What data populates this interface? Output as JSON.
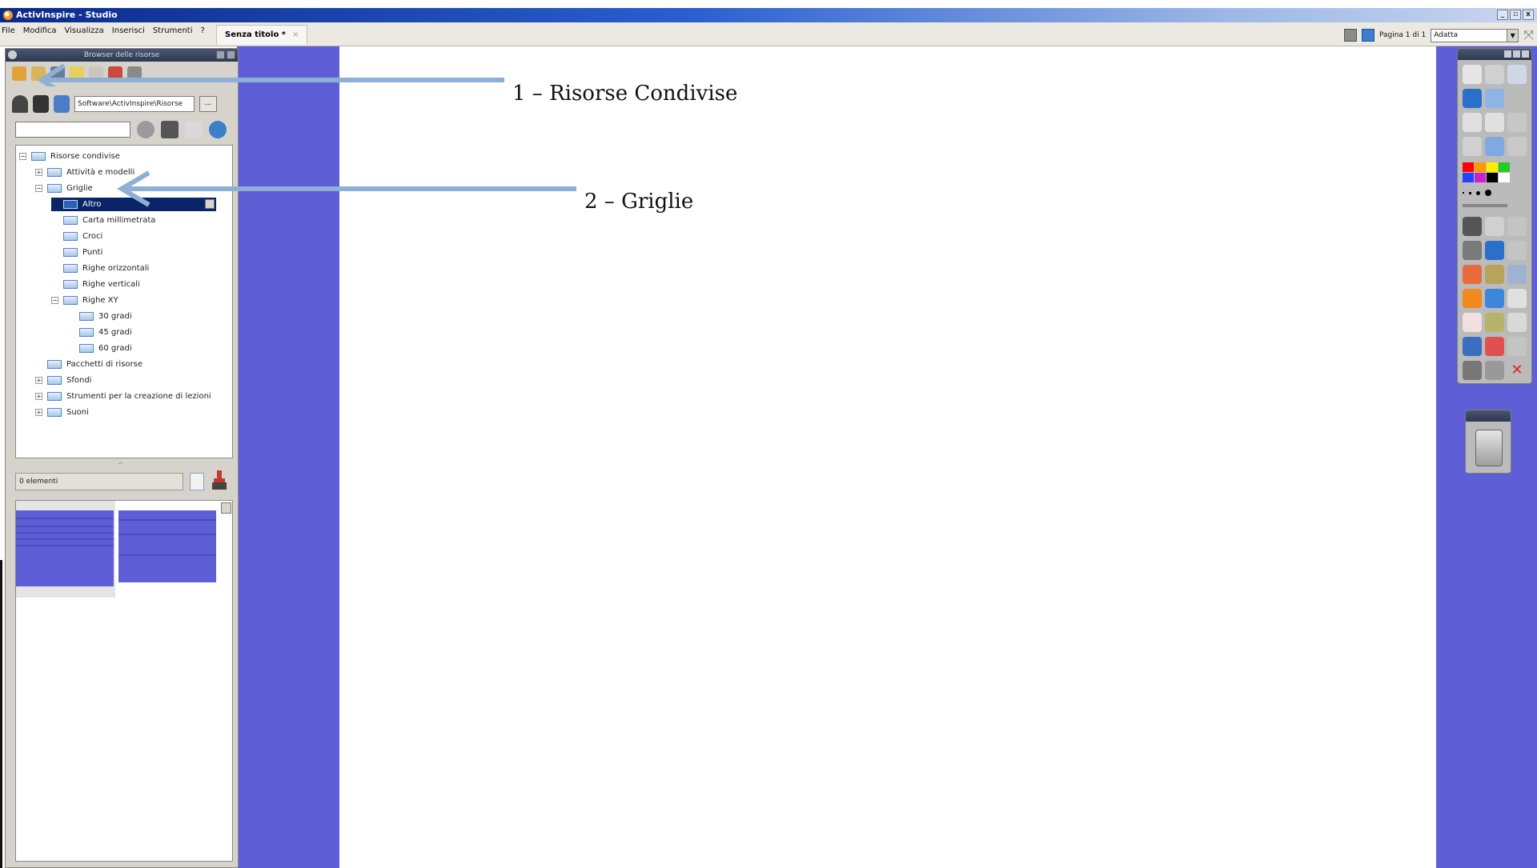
{
  "window": {
    "title": "ActivInspire - Studio",
    "controls": [
      "_",
      "▫",
      "x"
    ]
  },
  "menubar": {
    "items": [
      "File",
      "Modifica",
      "Visualizza",
      "Inserisci",
      "Strumenti",
      "?"
    ],
    "document_tab": "Senza titolo *",
    "page_indicator": "Pagina 1 di 1",
    "zoom_value": "Adatta"
  },
  "resource_browser": {
    "title": "Browser delle risorse",
    "path": "Software\\ActivInspire\\Risorse",
    "path_button": "...",
    "tree": [
      {
        "label": "Risorse condivise",
        "level": 0,
        "expander": "minus"
      },
      {
        "label": "Attività e modelli",
        "level": 1,
        "expander": "plus"
      },
      {
        "label": "Griglie",
        "level": 1,
        "expander": "minus"
      },
      {
        "label": "Altro",
        "level": 2,
        "expander": "none",
        "selected": true
      },
      {
        "label": "Carta millimetrata",
        "level": 2,
        "expander": "none"
      },
      {
        "label": "Croci",
        "level": 2,
        "expander": "none"
      },
      {
        "label": "Punti",
        "level": 2,
        "expander": "none"
      },
      {
        "label": "Righe orizzontali",
        "level": 2,
        "expander": "none"
      },
      {
        "label": "Righe verticali",
        "level": 2,
        "expander": "none"
      },
      {
        "label": "Righe XY",
        "level": 2,
        "expander": "minus"
      },
      {
        "label": "30 gradi",
        "level": 3,
        "expander": "none"
      },
      {
        "label": "45 gradi",
        "level": 3,
        "expander": "none"
      },
      {
        "label": "60 gradi",
        "level": 3,
        "expander": "none"
      },
      {
        "label": "Pacchetti di risorse",
        "level": 1,
        "expander": "none"
      },
      {
        "label": "Sfondi",
        "level": 1,
        "expander": "plus"
      },
      {
        "label": "Strumenti per la creazione di lezioni",
        "level": 1,
        "expander": "plus"
      },
      {
        "label": "Suoni",
        "level": 1,
        "expander": "plus"
      }
    ],
    "item_count": "0 elementi"
  },
  "annotations": [
    {
      "text": "1 – Risorse Condivise"
    },
    {
      "text": "2 – Griglie"
    }
  ],
  "colors": {
    "canvas_background": "#5e5ed6",
    "annotation_arrow": "#8eb0d6",
    "selection": "#0a246a"
  }
}
